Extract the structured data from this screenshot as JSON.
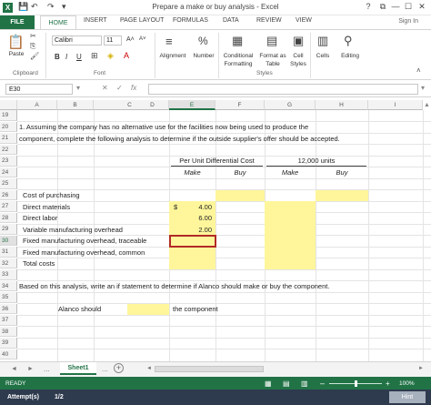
{
  "titlebar": {
    "app_icon": "X",
    "title": "Prepare a make or buy analysis - Excel",
    "help": "?",
    "restore": "⧉",
    "minimize": "—",
    "maximize": "☐",
    "close": "✕"
  },
  "ribbon_tabs": {
    "file": "FILE",
    "home": "HOME",
    "insert": "INSERT",
    "page_layout": "PAGE LAYOUT",
    "formulas": "FORMULAS",
    "data": "DATA",
    "review": "REVIEW",
    "view": "VIEW",
    "sign_in": "Sign In"
  },
  "ribbon": {
    "paste": "Paste",
    "clipboard": "Clipboard",
    "font_name": "Calibri",
    "font_size": "11",
    "bold": "B",
    "italic": "I",
    "underline": "U",
    "font": "Font",
    "alignment": "Alignment",
    "number": "Number",
    "cond_format_1": "Conditional",
    "cond_format_2": "Formatting",
    "format_table_1": "Format as",
    "format_table_2": "Table",
    "cell_styles_1": "Cell",
    "cell_styles_2": "Styles",
    "styles": "Styles",
    "cells": "Cells",
    "editing": "Editing"
  },
  "formula_bar": {
    "name_box": "E30",
    "cancel": "✕",
    "enter": "✓",
    "fx": "fx",
    "value": ""
  },
  "columns": [
    "A",
    "B",
    "C",
    "D",
    "E",
    "F",
    "G",
    "H",
    "I"
  ],
  "rows": [
    "19",
    "20",
    "21",
    "22",
    "23",
    "24",
    "25",
    "26",
    "27",
    "28",
    "29",
    "30",
    "31",
    "32",
    "33",
    "34",
    "35",
    "36",
    "37",
    "38",
    "39",
    "40"
  ],
  "sheet": {
    "r20": "1. Assuming the company has no alternative use for the facilities now being used to produce the",
    "r21": "component, complete the following analysis to determine if the outside supplier's offer should be accepted.",
    "h_per_unit": "Per Unit Differential Cost",
    "h_units": "12,000 units",
    "make": "Make",
    "buy": "Buy",
    "make2": "Make",
    "buy2": "Buy",
    "cost_purchasing": "Cost of purchasing",
    "direct_materials": "Direct materials",
    "dollar": "$",
    "dm_value": "4.00",
    "direct_labor": "Direct labor",
    "dl_value": "6.00",
    "var_overhead": "Variable manufacturing overhead",
    "vo_value": "2.00",
    "fixed_traceable": "Fixed manufacturing overhead, traceable",
    "fixed_common": "Fixed manufacturing overhead, common",
    "total_costs": "Total costs",
    "r34": "Based on this analysis, write an if statement to determine if Alanco should make or buy the component.",
    "alanco_should": "Alanco should",
    "the_component": "the component"
  },
  "sheet_tabs": {
    "prev": "◄",
    "next": "►",
    "more_left": "...",
    "active": "Sheet1",
    "more_right": "...",
    "add": "+"
  },
  "status": {
    "ready": "READY",
    "zoom_minus": "–",
    "zoom_plus": "+",
    "zoom": "100%",
    "zoom_level": 1.0
  },
  "bottom": {
    "attempts_label": "Attempt(s)",
    "attempts_value": "1/2",
    "hint": "Hint"
  }
}
